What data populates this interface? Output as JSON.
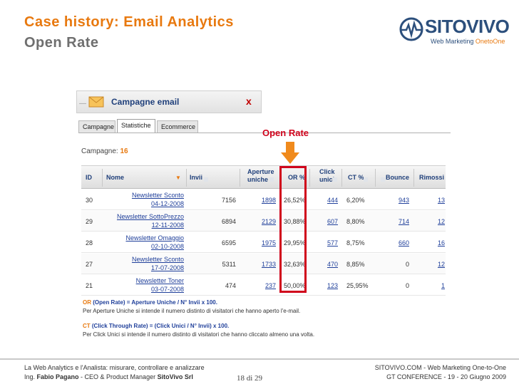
{
  "slide": {
    "title": "Case history: Email Analytics",
    "subtitle": "Open Rate",
    "logo_text": "SITOVIVO",
    "logo_tagline_a": "Web Marketing ",
    "logo_tagline_b": "OnetoOne"
  },
  "panel": {
    "title": "Campagne email",
    "close": "x",
    "tabs": [
      "Campagne",
      "Statistiche",
      "Ecommerce"
    ],
    "active_tab": "Statistiche",
    "campaign_count_label": "Campagne:",
    "campaign_count": "16",
    "callout": "Open Rate"
  },
  "table": {
    "headers": {
      "id": "ID",
      "nome": "Nome",
      "invii": "Invii",
      "aperture1": "Aperture",
      "aperture2": "uniche",
      "or": "OR %",
      "click1": "Click",
      "click2": "unici",
      "ct": "CT %",
      "bounce": "Bounce",
      "rimossi": "Rimossi"
    },
    "rows": [
      {
        "id": "30",
        "name": "Newsletter Sconto",
        "date": "04-12-2008",
        "invii": "7156",
        "aperture": "1898",
        "or": "26,52%",
        "click": "444",
        "ct": "6,20%",
        "bounce": "943",
        "rimossi": "13"
      },
      {
        "id": "29",
        "name": "Newsletter SottoPrezzo",
        "date": "12-11-2008",
        "invii": "6894",
        "aperture": "2129",
        "or": "30,88%",
        "click": "607",
        "ct": "8,80%",
        "bounce": "714",
        "rimossi": "12"
      },
      {
        "id": "28",
        "name": "Newsletter Omaggio",
        "date": "02-10-2008",
        "invii": "6595",
        "aperture": "1975",
        "or": "29,95%",
        "click": "577",
        "ct": "8,75%",
        "bounce": "660",
        "rimossi": "16"
      },
      {
        "id": "27",
        "name": "Newsletter Sconto",
        "date": "17-07-2008",
        "invii": "5311",
        "aperture": "1733",
        "or": "32,63%",
        "click": "470",
        "ct": "8,85%",
        "bounce": "0",
        "rimossi": "12"
      },
      {
        "id": "21",
        "name": "Newsletter Toner",
        "date": "03-07-2008",
        "invii": "474",
        "aperture": "237",
        "or": "50,00%",
        "click": "123",
        "ct": "25,95%",
        "bounce": "0",
        "rimossi": "1"
      }
    ]
  },
  "notes": {
    "or_abbr": "OR",
    "or_formula": " (Open Rate) = Aperture Uniche / N° Invii x 100.",
    "or_desc": "Per Aperture Uniche si intende il numero distinto di visitatori che hanno aperto l'e-mail.",
    "ct_abbr": "CT",
    "ct_formula": " (Click Through Rate) = (Click Unici / N° Invii) x 100.",
    "ct_desc": "Per Click Unici si intende il numero distinto di visitatori che hanno cliccato almeno una volta."
  },
  "footer": {
    "left1": "La Web Analytics e l'Analista: misurare, controllare e analizzare",
    "left2_a": "Ing. ",
    "left2_b": "Fabio Pagano",
    "left2_c": " - CEO & Product Manager ",
    "left2_d": "SitoVivo Srl",
    "page": "18 di 29",
    "right1": "SITOVIVO.COM - Web Marketing One-to-One",
    "right2": "GT CONFERENCE - 19 - 20 Giugno 2009"
  },
  "colors": {
    "accent": "#e8790f",
    "brand": "#2c4f7c",
    "highlight": "#d0021b"
  }
}
